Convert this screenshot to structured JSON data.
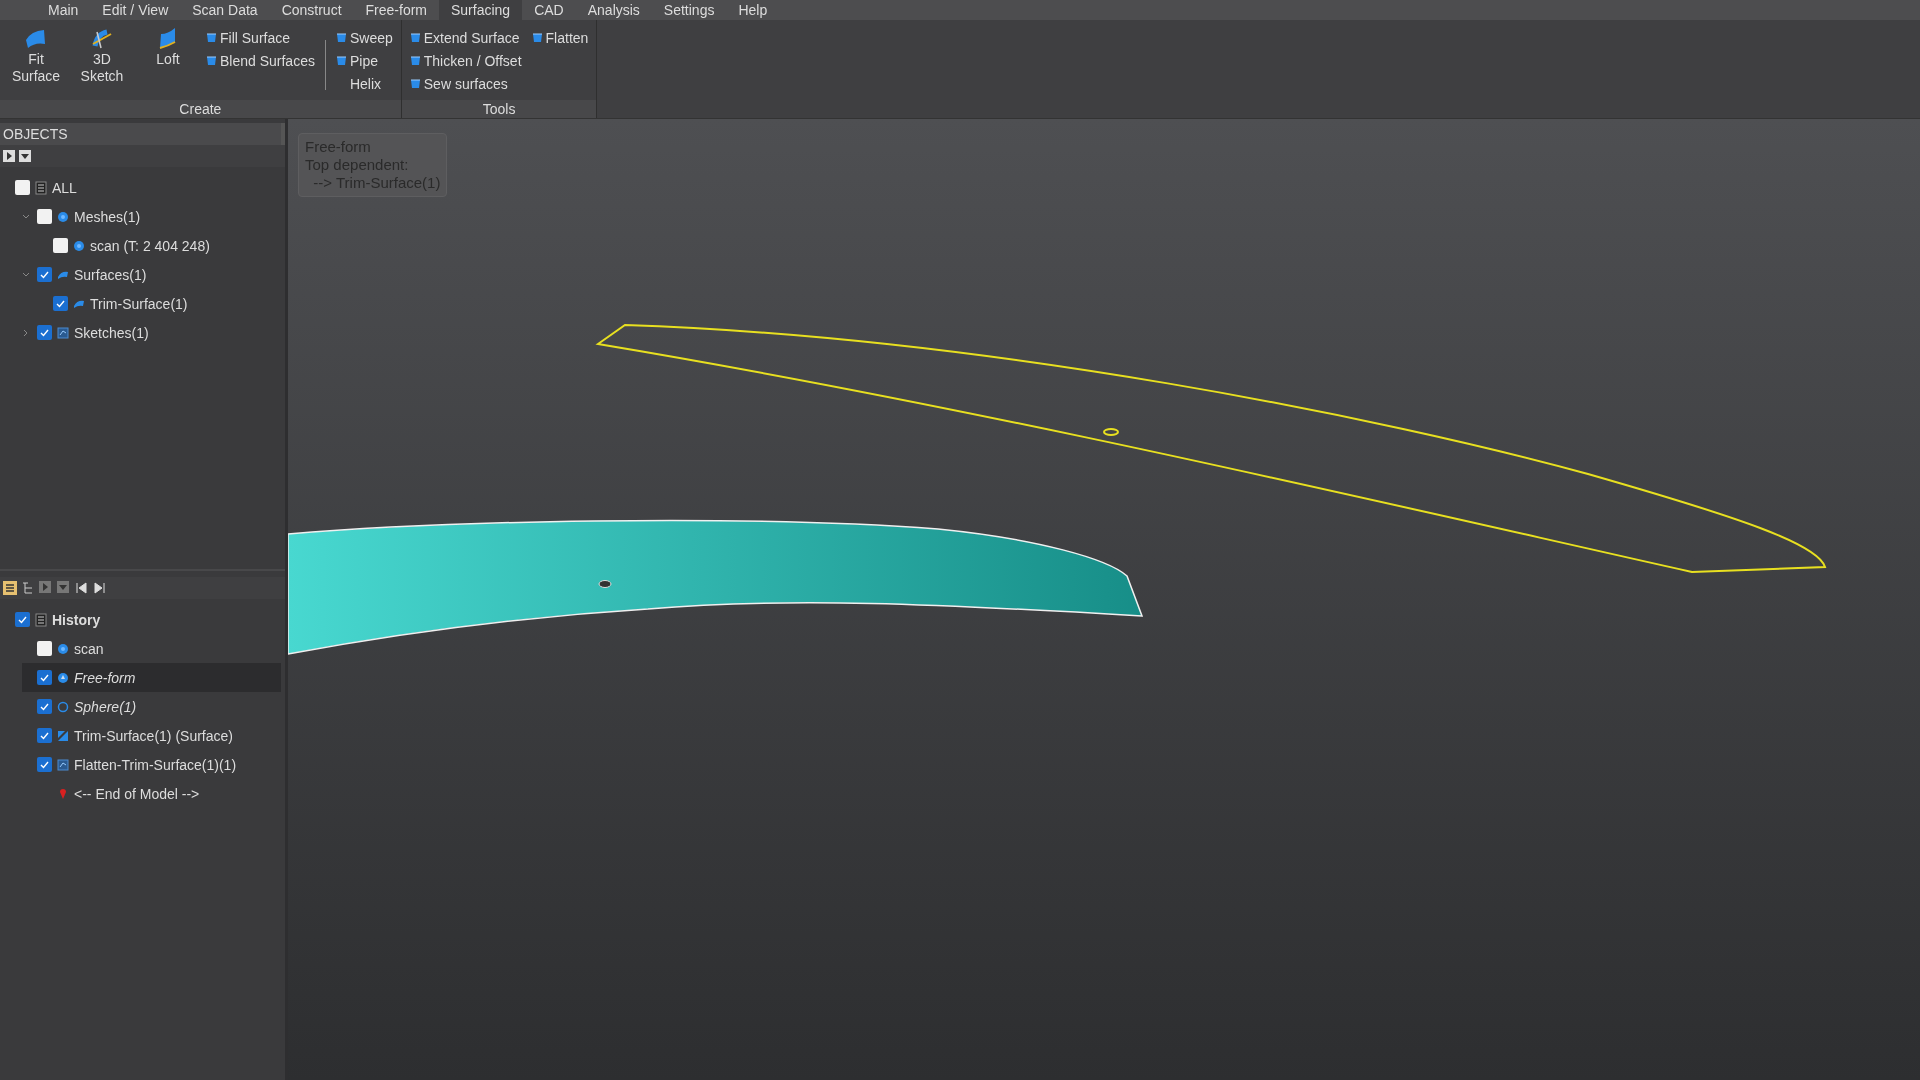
{
  "menu": [
    {
      "label": "Main",
      "selected": false
    },
    {
      "label": "Edit / View",
      "selected": false
    },
    {
      "label": "Scan Data",
      "selected": false
    },
    {
      "label": "Construct",
      "selected": false
    },
    {
      "label": "Free-form",
      "selected": false
    },
    {
      "label": "Surfacing",
      "selected": true
    },
    {
      "label": "CAD",
      "selected": false
    },
    {
      "label": "Analysis",
      "selected": false
    },
    {
      "label": "Settings",
      "selected": false
    },
    {
      "label": "Help",
      "selected": false
    }
  ],
  "ribbon": {
    "groups": [
      {
        "label": "Create",
        "columns": [
          {
            "kind": "large",
            "items": [
              {
                "label": "Fit Surface",
                "icon": true
              }
            ]
          },
          {
            "kind": "large",
            "items": [
              {
                "label": "3D Sketch",
                "icon": true
              }
            ]
          },
          {
            "kind": "large",
            "items": [
              {
                "label": "Loft",
                "icon": true
              }
            ]
          },
          {
            "kind": "small",
            "items": [
              {
                "label": "Fill Surface",
                "icon": true
              },
              {
                "label": "Blend Surfaces",
                "icon": true
              }
            ]
          },
          {
            "kind": "separator"
          },
          {
            "kind": "small",
            "items": [
              {
                "label": "Sweep",
                "icon": true
              },
              {
                "label": "Pipe",
                "icon": true
              },
              {
                "label": "Helix",
                "icon": false
              }
            ]
          }
        ]
      },
      {
        "label": "Tools",
        "columns": [
          {
            "kind": "small",
            "items": [
              {
                "label": "Extend Surface",
                "icon": true
              },
              {
                "label": "Thicken / Offset",
                "icon": true
              },
              {
                "label": "Sew surfaces",
                "icon": true
              }
            ]
          },
          {
            "kind": "small",
            "items": [
              {
                "label": "Flatten",
                "icon": true
              }
            ]
          }
        ]
      }
    ]
  },
  "objects": {
    "header": "OBJECTS",
    "tree": [
      {
        "label": "ALL",
        "kind": "all",
        "checked": false,
        "children": [
          {
            "label": "Meshes(1)",
            "kind": "mesh",
            "checked": false,
            "expanded": true,
            "children": [
              {
                "label": "scan (T: 2 404 248)",
                "kind": "mesh",
                "checked": false
              }
            ]
          },
          {
            "label": "Surfaces(1)",
            "kind": "surface",
            "checked": true,
            "expanded": true,
            "children": [
              {
                "label": "Trim-Surface(1)",
                "kind": "surface",
                "checked": true
              }
            ]
          },
          {
            "label": "Sketches(1)",
            "kind": "sketch",
            "checked": true,
            "expanded": false
          }
        ]
      }
    ]
  },
  "history": {
    "tree": [
      {
        "label": "History",
        "kind": "root",
        "checked": true,
        "selected": false,
        "italic": false,
        "children": [
          {
            "label": "scan",
            "kind": "mesh",
            "checked": false,
            "selected": false,
            "italic": false
          },
          {
            "label": "Free-form",
            "kind": "freeform",
            "checked": true,
            "selected": true,
            "italic": true
          },
          {
            "label": "Sphere(1)",
            "kind": "sphere",
            "checked": true,
            "selected": false,
            "italic": true
          },
          {
            "label": "Trim-Surface(1) (Surface)",
            "kind": "trim",
            "checked": true,
            "selected": false,
            "italic": false
          },
          {
            "label": "Flatten-Trim-Surface(1)(1)",
            "kind": "sketch",
            "checked": true,
            "selected": false,
            "italic": false
          },
          {
            "label": "<-- End of Model -->",
            "kind": "end",
            "selected": false,
            "italic": false
          }
        ]
      }
    ]
  },
  "tooltip": {
    "lines": [
      "Free-form",
      "Top dependent:",
      "  --> Trim-Surface(1)"
    ]
  }
}
